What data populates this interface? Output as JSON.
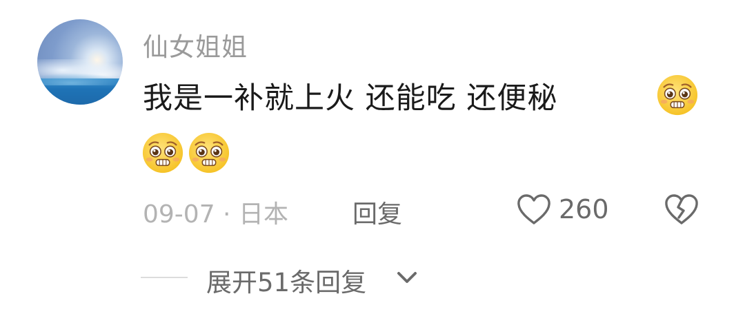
{
  "comment": {
    "username": "仙女姐姐",
    "text": "我是一补就上火  还能吃   还便秘",
    "emoji_name": "pleading-face-icon",
    "time": "09-07 · 日本",
    "reply_label": "回复",
    "like_count": "260",
    "expand_replies_label": "展开51条回复"
  },
  "colors": {
    "username": "#9a9a9a",
    "text": "#1a1a1a",
    "meta": "#b3b3b3",
    "action": "#6a6a6a"
  }
}
